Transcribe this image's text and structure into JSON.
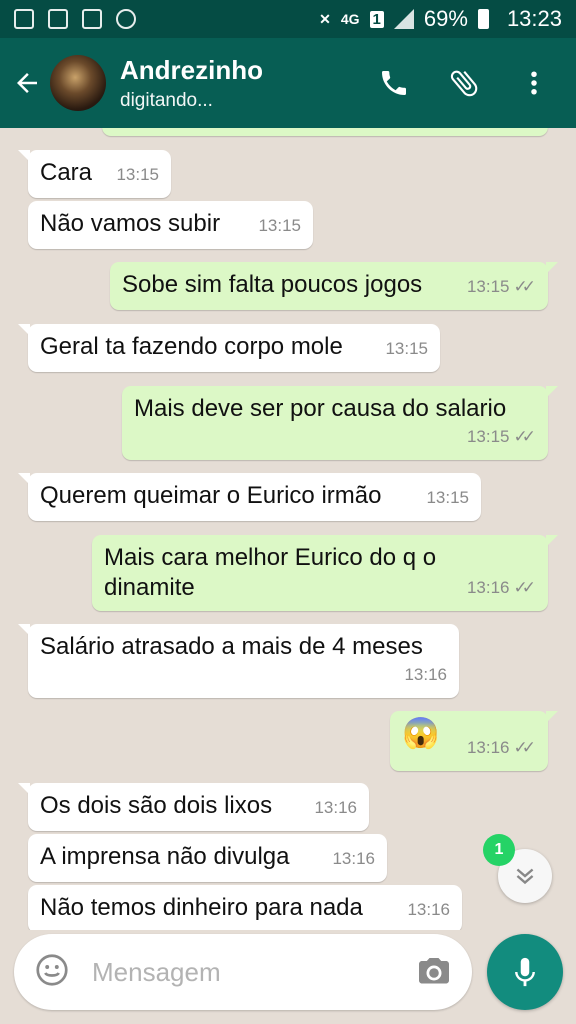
{
  "status_bar": {
    "battery": "69%",
    "time": "13:23",
    "network": "4G",
    "sim_slot": "1"
  },
  "header": {
    "contact_name": "Andrezinho",
    "status": "digitando..."
  },
  "messages": [
    {
      "dir": "in",
      "text": "Cara",
      "time": "13:15"
    },
    {
      "dir": "in",
      "text": "Não vamos subir",
      "time": "13:15"
    },
    {
      "dir": "out",
      "text": "Sobe sim falta poucos jogos",
      "time": "13:15"
    },
    {
      "dir": "in",
      "text": "Geral ta fazendo corpo mole",
      "time": "13:15"
    },
    {
      "dir": "out",
      "text": "Mais deve ser por causa do salario",
      "time": "13:15"
    },
    {
      "dir": "in",
      "text": "Querem queimar o Eurico irmão",
      "time": "13:15"
    },
    {
      "dir": "out",
      "text": "Mais cara melhor Eurico do q o dinamite",
      "time": "13:16"
    },
    {
      "dir": "in",
      "text": "Salário atrasado a mais de 4 meses",
      "time": "13:16"
    },
    {
      "dir": "out",
      "text": "😱",
      "time": "13:16"
    },
    {
      "dir": "in",
      "text": "Os dois são dois lixos",
      "time": "13:16"
    },
    {
      "dir": "in",
      "text": "A imprensa não divulga",
      "time": "13:16"
    },
    {
      "dir": "in",
      "text": "Não temos dinheiro para nada",
      "time": "13:16"
    }
  ],
  "unread_count": "1",
  "composer": {
    "placeholder": "Mensagem"
  },
  "icons": {
    "back": "arrow-left-icon",
    "call": "phone-icon",
    "attach": "paperclip-icon",
    "menu": "more-vert-icon",
    "emoji": "emoji-icon",
    "camera": "camera-icon",
    "mic": "mic-icon",
    "scroll": "chevron-double-down-icon"
  },
  "colors": {
    "header": "#075e54",
    "statusbar": "#054c44",
    "chat_bg": "#e5ddd5",
    "incoming": "#ffffff",
    "outgoing": "#dcf8c6",
    "accent": "#128c7e",
    "unread_badge": "#25d366"
  }
}
